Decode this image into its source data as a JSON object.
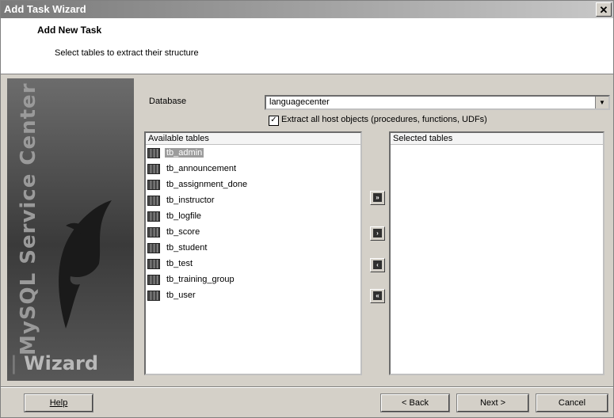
{
  "window": {
    "title": "Add Task Wizard",
    "close_glyph": "✕"
  },
  "header": {
    "title": "Add New Task",
    "subtitle": "Select tables to extract their structure"
  },
  "sidebar": {
    "brand": "MySQL Service Center",
    "wizard": "Wizard",
    "image": "dolphin-logo"
  },
  "database": {
    "label": "Database",
    "value": "languagecenter",
    "arrow_icon": "chevron-down-icon"
  },
  "extract": {
    "checked": true,
    "check_glyph": "✓",
    "label": "Extract all host objects (procedures, functions, UDFs)"
  },
  "available": {
    "header": "Available tables",
    "items": [
      {
        "label": "tb_admin",
        "selected": true
      },
      {
        "label": "tb_announcement",
        "selected": false
      },
      {
        "label": "tb_assignment_done",
        "selected": false
      },
      {
        "label": "tb_instructor",
        "selected": false
      },
      {
        "label": "tb_logfile",
        "selected": false
      },
      {
        "label": "tb_score",
        "selected": false
      },
      {
        "label": "tb_student",
        "selected": false
      },
      {
        "label": "tb_test",
        "selected": false
      },
      {
        "label": "tb_training_group",
        "selected": false
      },
      {
        "label": "tb_user",
        "selected": false
      }
    ]
  },
  "selected": {
    "header": "Selected tables",
    "items": []
  },
  "move_buttons": {
    "add_all": "»",
    "add_one": "›",
    "remove_one": "‹",
    "remove_all": "«"
  },
  "footer": {
    "help": "Help",
    "back": "< Back",
    "next": "Next >",
    "cancel": "Cancel"
  },
  "colors": {
    "face": "#d4d0c8",
    "selection": "#9c9c9c",
    "sidebar": "#3a3a3a"
  }
}
